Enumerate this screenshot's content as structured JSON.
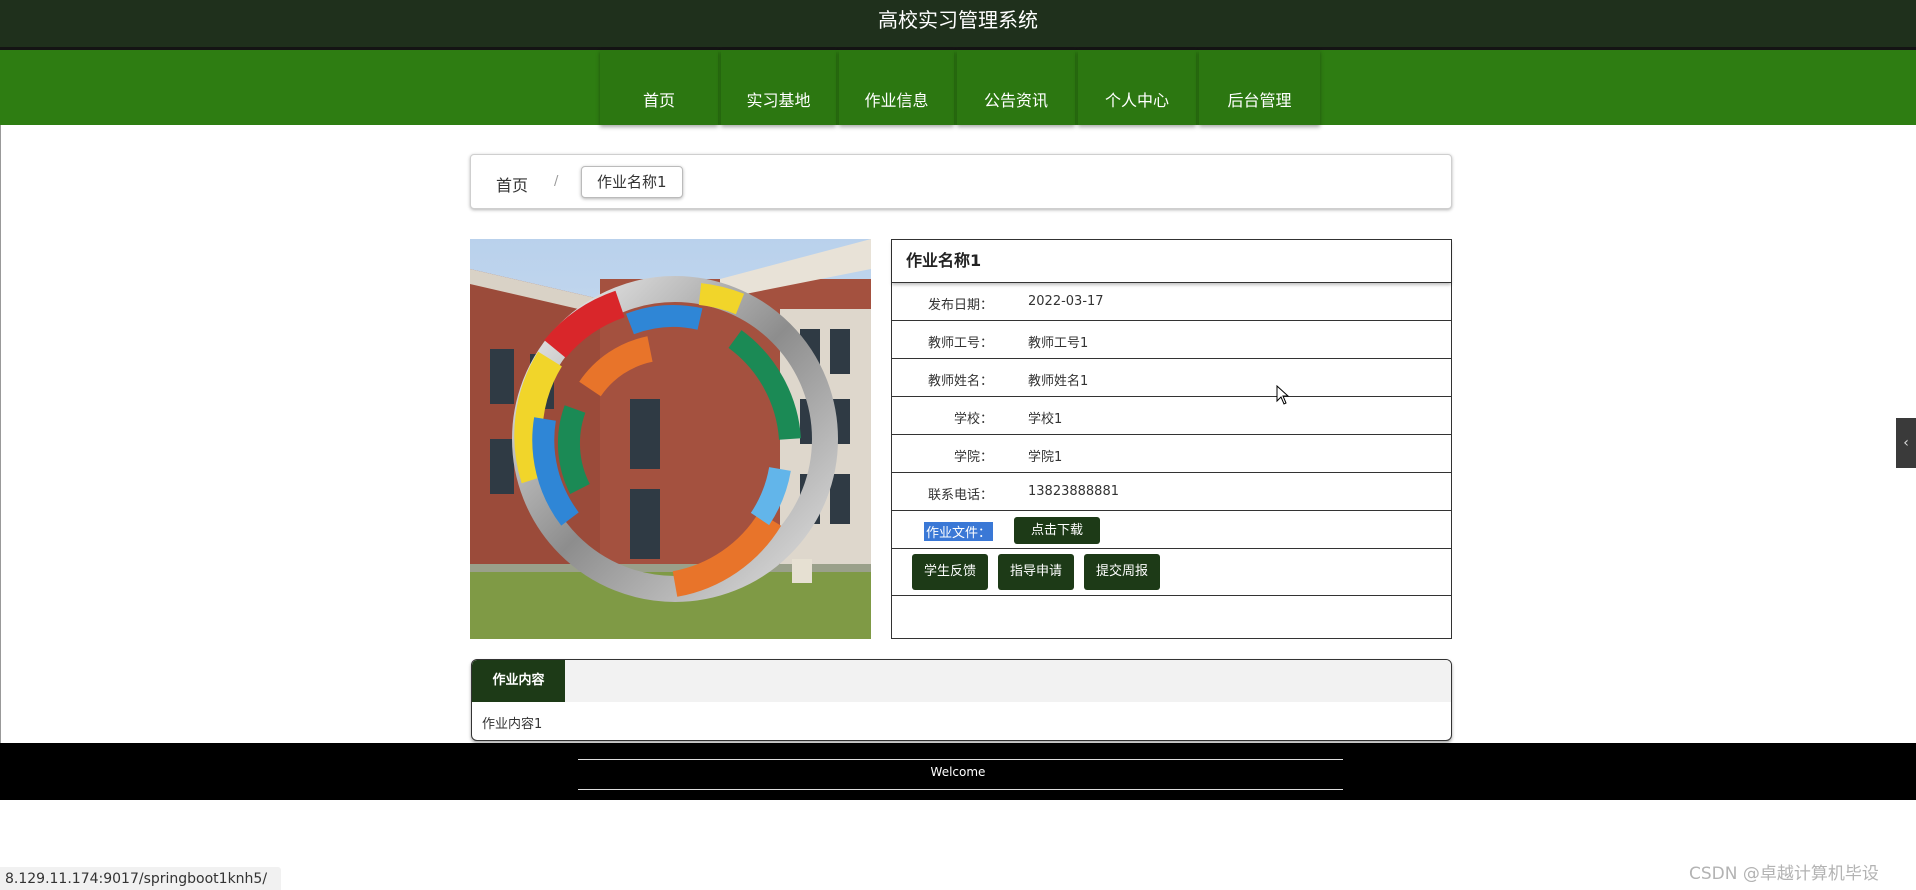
{
  "site": {
    "title": "高校实习管理系统"
  },
  "nav": {
    "items": [
      {
        "label": "首页"
      },
      {
        "label": "实习基地"
      },
      {
        "label": "作业信息"
      },
      {
        "label": "公告资讯"
      },
      {
        "label": "个人中心"
      },
      {
        "label": "后台管理"
      }
    ]
  },
  "breadcrumb": {
    "home": "首页",
    "separator": "/",
    "current": "作业名称1"
  },
  "detail": {
    "title": "作业名称1",
    "fields": [
      {
        "label": "发布日期：",
        "value": "2022-03-17"
      },
      {
        "label": "教师工号：",
        "value": "教师工号1"
      },
      {
        "label": "教师姓名：",
        "value": "教师姓名1"
      },
      {
        "label": "学校：",
        "value": "学校1"
      },
      {
        "label": "学院：",
        "value": "学院1"
      },
      {
        "label": "联系电话：",
        "value": "13823888881"
      }
    ],
    "file_label": "作业文件：",
    "download_label": "点击下载",
    "actions": [
      {
        "label": "学生反馈"
      },
      {
        "label": "指导申请"
      },
      {
        "label": "提交周报"
      }
    ]
  },
  "content": {
    "tab_label": "作业内容",
    "text": "作业内容1"
  },
  "footer": {
    "welcome": "Welcome"
  },
  "browser": {
    "status_url": "8.129.11.174:9017/springboot1knh5/"
  },
  "watermark": "CSDN @卓越计算机毕设",
  "colors": {
    "header_bg": "#1f301c",
    "nav_bg": "#2e7d12",
    "button_bg": "#1d3a17",
    "footer_bg": "#000000"
  }
}
